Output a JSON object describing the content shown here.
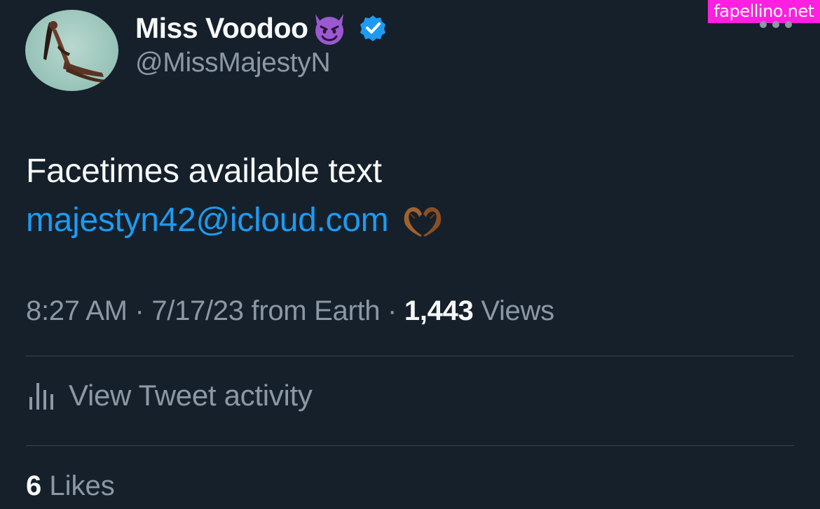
{
  "watermark": "fapellino.net",
  "tweet": {
    "author": {
      "display_name": "Miss Voodoo",
      "name_emoji": "smiling-face-with-horns",
      "verified": true,
      "handle": "@MissMajestyN",
      "avatar": "profile-photo"
    },
    "text_line1": "Facetimes available text",
    "link_text": "majestyn42@icloud.com",
    "trailing_emoji": "heart-hands-medium-dark-skin-tone",
    "time": "8:27 AM",
    "sep1": " · ",
    "date": "7/17/23",
    "source": " from Earth",
    "sep2": " · ",
    "views_count": "1,443",
    "views_label": " Views",
    "activity_label": "View Tweet activity",
    "likes_count": "6",
    "likes_label": " Likes"
  },
  "colors": {
    "background": "#15202b",
    "text_primary": "#f7f9f9",
    "text_secondary": "#8b98a5",
    "link": "#1d9bf0",
    "verified_badge": "#1d9bf0",
    "divider": "#38444d",
    "watermark_bg": "#ff1fe0"
  }
}
